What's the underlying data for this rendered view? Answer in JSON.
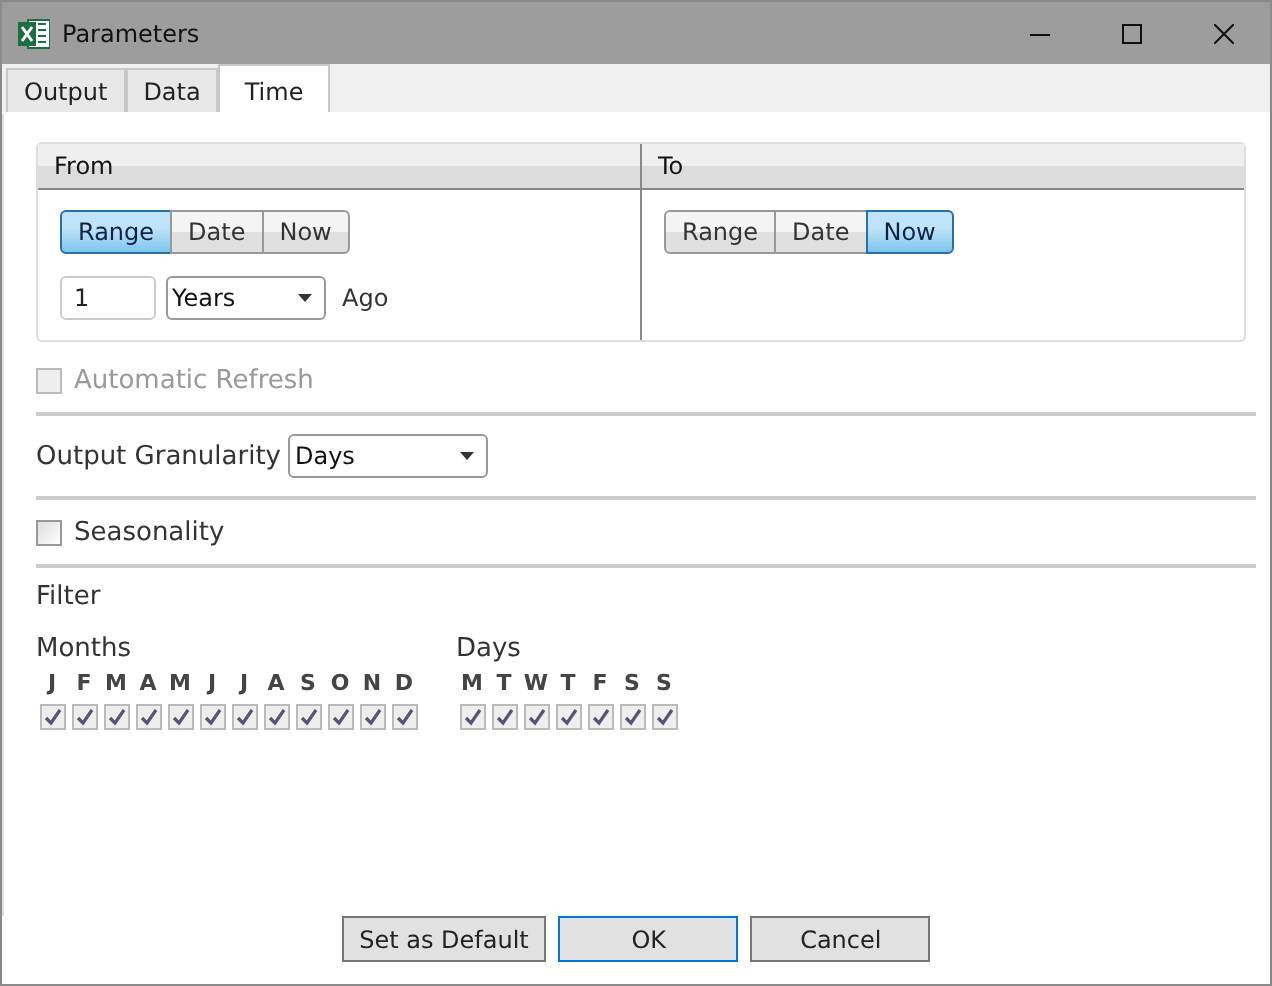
{
  "window": {
    "title": "Parameters"
  },
  "tabs": [
    {
      "label": "Output",
      "selected": false
    },
    {
      "label": "Data",
      "selected": false
    },
    {
      "label": "Time",
      "selected": true
    }
  ],
  "from": {
    "title": "From",
    "modes": [
      {
        "label": "Range",
        "selected": true
      },
      {
        "label": "Date",
        "selected": false
      },
      {
        "label": "Now",
        "selected": false
      }
    ],
    "amount": "1",
    "unit": "Years",
    "suffix": "Ago"
  },
  "to": {
    "title": "To",
    "modes": [
      {
        "label": "Range",
        "selected": false
      },
      {
        "label": "Date",
        "selected": false
      },
      {
        "label": "Now",
        "selected": true
      }
    ]
  },
  "automatic_refresh": {
    "label": "Automatic Refresh",
    "checked": false,
    "disabled": true
  },
  "output_granularity": {
    "label": "Output Granularity",
    "value": "Days"
  },
  "seasonality": {
    "label": "Seasonality",
    "checked": false,
    "disabled": false
  },
  "filter": {
    "title": "Filter",
    "groups": [
      {
        "label": "Months",
        "disabled": true,
        "items": [
          {
            "label": "J",
            "checked": true
          },
          {
            "label": "F",
            "checked": true
          },
          {
            "label": "M",
            "checked": true
          },
          {
            "label": "A",
            "checked": true
          },
          {
            "label": "M",
            "checked": true
          },
          {
            "label": "J",
            "checked": true
          },
          {
            "label": "J",
            "checked": true
          },
          {
            "label": "A",
            "checked": true
          },
          {
            "label": "S",
            "checked": true
          },
          {
            "label": "O",
            "checked": true
          },
          {
            "label": "N",
            "checked": true
          },
          {
            "label": "D",
            "checked": true
          }
        ]
      },
      {
        "label": "Days",
        "disabled": true,
        "items": [
          {
            "label": "M",
            "checked": true
          },
          {
            "label": "T",
            "checked": true
          },
          {
            "label": "W",
            "checked": true
          },
          {
            "label": "T",
            "checked": true
          },
          {
            "label": "F",
            "checked": true
          },
          {
            "label": "S",
            "checked": true
          },
          {
            "label": "S",
            "checked": true
          }
        ]
      }
    ]
  },
  "buttons": [
    {
      "label": "Set as Default",
      "default": false
    },
    {
      "label": "OK",
      "default": true
    },
    {
      "label": "Cancel",
      "default": false
    }
  ]
}
